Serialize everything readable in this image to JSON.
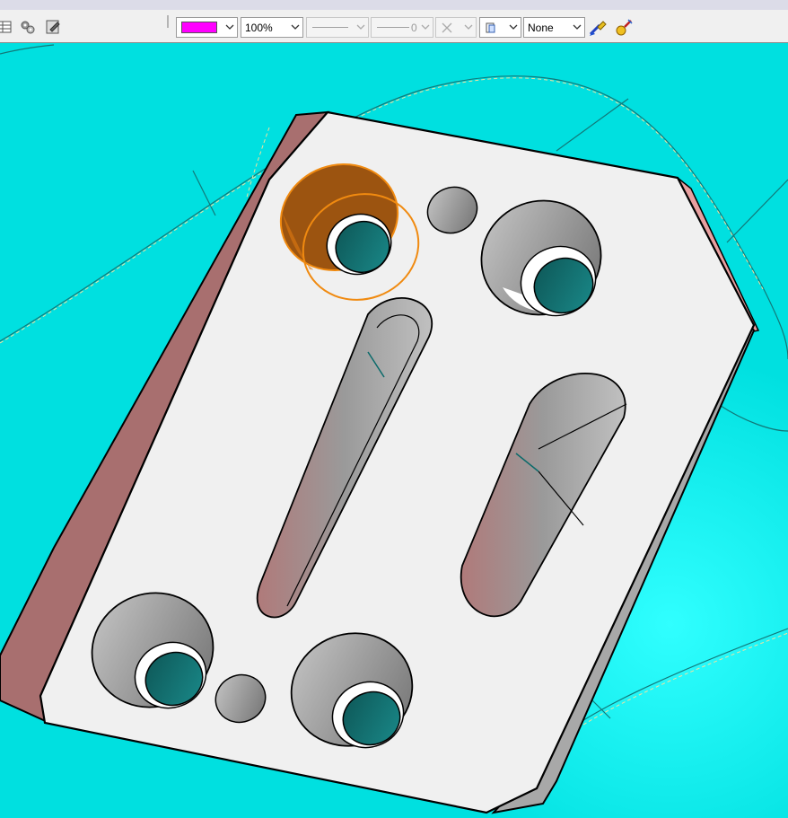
{
  "toolbar": {
    "left_icons": [
      "table-icon",
      "gears-icon",
      "edit-sheet-icon"
    ],
    "fill_color": {
      "value": "#ff00ff"
    },
    "transparency": {
      "value": "100%"
    },
    "line_style": {
      "value": "solid"
    },
    "line_weight": {
      "value": "0"
    },
    "line_end": {
      "value": "none-x"
    },
    "layer_select": {
      "value": "layer"
    },
    "shadow": {
      "value": "None"
    },
    "format_painter_icon": "paint-brush-icon",
    "magic_wand_icon": "magic-wand-icon"
  },
  "viewport": {
    "background": "#00e0e0",
    "part_face_color": "#f0f0f0",
    "part_side_color": "#b07a7a",
    "hole_inner_color": "#0a6a6a",
    "selection_color": "#f08a10",
    "holes": [
      "counterbore-top-left",
      "small-hole-top",
      "counterbore-top-right",
      "slot-left",
      "slot-right",
      "counterbore-bottom-left",
      "small-hole-bottom",
      "counterbore-bottom-right"
    ]
  }
}
